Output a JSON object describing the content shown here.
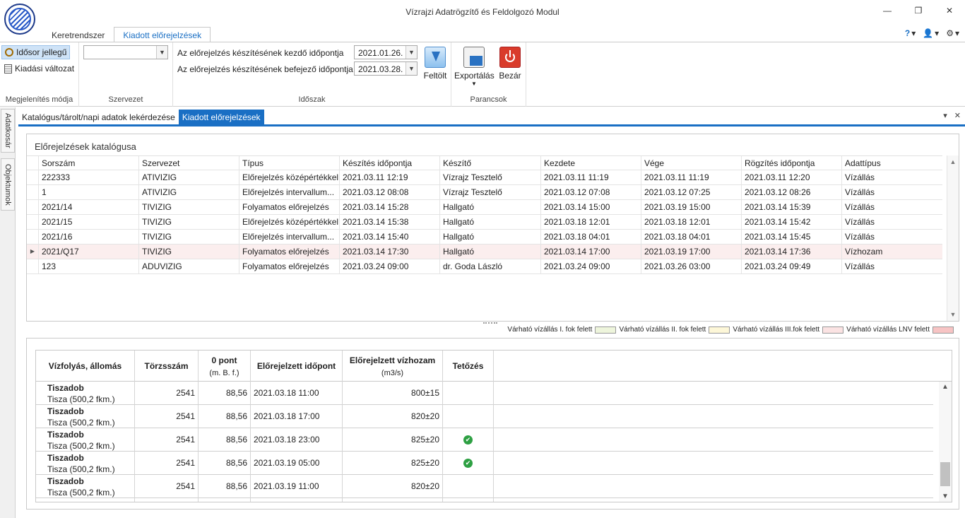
{
  "window": {
    "title": "Vízrajzi Adatrögzítő és Feldolgozó Modul",
    "minimize": "—",
    "restore": "❐",
    "close": "✕"
  },
  "ribbon_tabs": [
    "Keretrendszer",
    "Kiadott előrejelzések"
  ],
  "help_menu": {
    "help_icon": "?",
    "user_icon": "👤",
    "settings_icon": "⚙",
    "caret": "▾"
  },
  "ribbon": {
    "view_mode": {
      "label": "Megjelenítés módja",
      "timeseries": "Idősor jellegű",
      "release": "Kiadási változat"
    },
    "organization": {
      "label": "Szervezet",
      "value": ""
    },
    "period": {
      "label": "Időszak",
      "start_label": "Az előrejelzés készítésének kezdő időpontja",
      "start_value": "2021.01.26.",
      "end_label": "Az előrejelzés készítésének befejező időpontja",
      "end_value": "2021.03.28.",
      "load_button": "Feltölt"
    },
    "commands": {
      "label": "Parancsok",
      "export": "Exportálás",
      "close": "Bezár"
    }
  },
  "side_tabs": [
    "Adatkosár",
    "Objektumok"
  ],
  "doc_tabs": [
    "Katalógus/tárolt/napi adatok lekérdezése",
    "Kiadott előrejelzések"
  ],
  "doc_ctrls": {
    "dropdown": "▾",
    "close": "✕"
  },
  "catalog": {
    "title": "Előrejelzések katalógusa",
    "columns": [
      "Sorszám",
      "Szervezet",
      "Típus",
      "Készítés időpontja",
      "Készítő",
      "Kezdete",
      "Vége",
      "Rögzítés időpontja",
      "Adattípus"
    ],
    "rows": [
      [
        "222333",
        "ATIVIZIG",
        "Előrejelzés középértékkel",
        "2021.03.11 12:19",
        "Vízrajz Tesztelő",
        "2021.03.11 11:19",
        "2021.03.11 11:19",
        "2021.03.11 12:20",
        "Vízállás"
      ],
      [
        "1",
        "ATIVIZIG",
        "Előrejelzés intervallum...",
        "2021.03.12 08:08",
        "Vízrajz Tesztelő",
        "2021.03.12 07:08",
        "2021.03.12 07:25",
        "2021.03.12 08:26",
        "Vízállás"
      ],
      [
        "2021/14",
        "TIVIZIG",
        "Folyamatos előrejelzés",
        "2021.03.14 15:28",
        "Hallgató",
        "2021.03.14 15:00",
        "2021.03.19 15:00",
        "2021.03.14 15:39",
        "Vízállás"
      ],
      [
        "2021/15",
        "TIVIZIG",
        "Előrejelzés középértékkel",
        "2021.03.14 15:38",
        "Hallgató",
        "2021.03.18 12:01",
        "2021.03.18 12:01",
        "2021.03.14 15:42",
        "Vízállás"
      ],
      [
        "2021/16",
        "TIVIZIG",
        "Előrejelzés intervallum...",
        "2021.03.14 15:40",
        "Hallgató",
        "2021.03.18 04:01",
        "2021.03.18 04:01",
        "2021.03.14 15:45",
        "Vízállás"
      ],
      [
        "2021/Q17",
        "TIVIZIG",
        "Folyamatos előrejelzés",
        "2021.03.14 17:30",
        "Hallgató",
        "2021.03.14 17:00",
        "2021.03.19 17:00",
        "2021.03.14 17:36",
        "Vízhozam"
      ],
      [
        "123",
        "ADUVIZIG",
        "Folyamatos előrejelzés",
        "2021.03.24 09:00",
        "dr. Goda László",
        "2021.03.24 09:00",
        "2021.03.26 03:00",
        "2021.03.24 09:49",
        "Vízállás"
      ]
    ],
    "current_row_indicator": "▶"
  },
  "legend": [
    {
      "label": "Várható vízállás I. fok felett",
      "color": "#eef5dc"
    },
    {
      "label": "Várható vízállás II. fok felett",
      "color": "#fdf7d8"
    },
    {
      "label": "Várható vízállás III.fok felett",
      "color": "#fbe3e3"
    },
    {
      "label": "Várható vízállás LNV felett",
      "color": "#f7c4c4"
    }
  ],
  "forecast": {
    "columns": {
      "station": "Vízfolyás, állomás",
      "registry": "Törzsszám",
      "zero_point": "0 pont",
      "zero_point_unit": "(m. B. f.)",
      "time": "Előrejelzett időpont",
      "discharge": "Előrejelzett vízhozam",
      "discharge_unit": "(m3/s)",
      "peak": "Tetőzés"
    },
    "rows": [
      {
        "station": "Tiszadob",
        "river": "Tisza (500,2 fkm.)",
        "registry": "2541",
        "zero": "88,56",
        "time": "2021.03.18 11:00",
        "discharge": "800±15",
        "peak": ""
      },
      {
        "station": "Tiszadob",
        "river": "Tisza (500,2 fkm.)",
        "registry": "2541",
        "zero": "88,56",
        "time": "2021.03.18 17:00",
        "discharge": "820±20",
        "peak": ""
      },
      {
        "station": "Tiszadob",
        "river": "Tisza (500,2 fkm.)",
        "registry": "2541",
        "zero": "88,56",
        "time": "2021.03.18 23:00",
        "discharge": "825±20",
        "peak": "✔"
      },
      {
        "station": "Tiszadob",
        "river": "Tisza (500,2 fkm.)",
        "registry": "2541",
        "zero": "88,56",
        "time": "2021.03.19 05:00",
        "discharge": "825±20",
        "peak": "✔"
      },
      {
        "station": "Tiszadob",
        "river": "Tisza (500,2 fkm.)",
        "registry": "2541",
        "zero": "88,56",
        "time": "2021.03.19 11:00",
        "discharge": "820±20",
        "peak": ""
      }
    ]
  },
  "scroll": {
    "up": "▲",
    "down": "▼"
  }
}
